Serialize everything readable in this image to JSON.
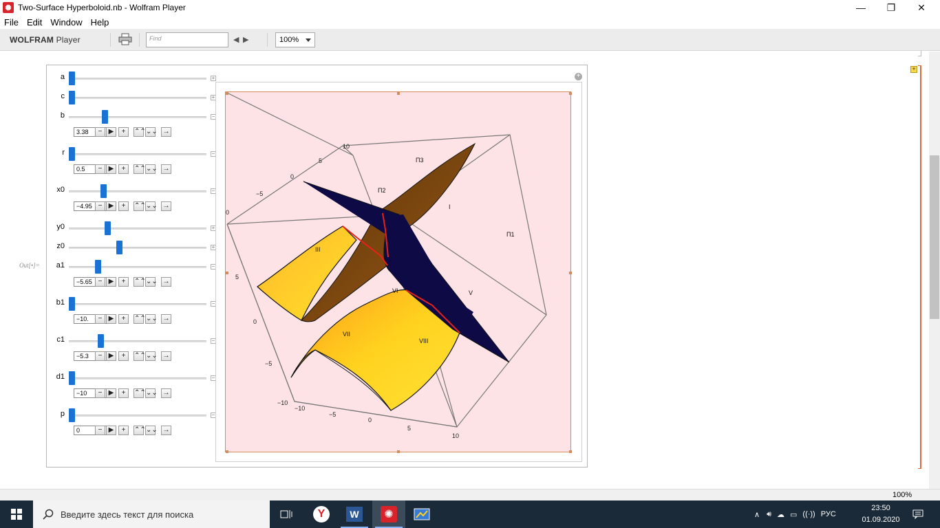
{
  "window": {
    "title": "Two-Surface Hyperboloid.nb - Wolfram Player",
    "minimize": "—",
    "maximize": "❐",
    "close": "✕"
  },
  "menu": [
    "File",
    "Edit",
    "Window",
    "Help"
  ],
  "toolbar": {
    "brand_bold": "WOLFRAM",
    "brand_rest": " Player",
    "find_placeholder": "Find",
    "zoom": "100%"
  },
  "notebook": {
    "out_label": "Out[•]="
  },
  "controls": [
    {
      "label": "a",
      "thumb": 0.0,
      "expanded": false
    },
    {
      "label": "c",
      "thumb": 0.0,
      "expanded": false
    },
    {
      "label": "b",
      "thumb": 0.25,
      "expanded": true,
      "value": "3.38"
    },
    {
      "label": "r",
      "thumb": 0.0,
      "expanded": true,
      "value": "0.5"
    },
    {
      "label": "x0",
      "thumb": 0.24,
      "expanded": true,
      "value": "−4.95"
    },
    {
      "label": "y0",
      "thumb": 0.27,
      "expanded": false
    },
    {
      "label": "z0",
      "thumb": 0.36,
      "expanded": false
    },
    {
      "label": "a1",
      "thumb": 0.2,
      "expanded": true,
      "value": "−5.65"
    },
    {
      "label": "b1",
      "thumb": 0.0,
      "expanded": true,
      "value": "−10."
    },
    {
      "label": "c1",
      "thumb": 0.22,
      "expanded": true,
      "value": "−5.3"
    },
    {
      "label": "d1",
      "thumb": 0.0,
      "expanded": true,
      "value": "−10"
    },
    {
      "label": "p",
      "thumb": 0.0,
      "expanded": true,
      "value": "0"
    }
  ],
  "plot": {
    "colors": {
      "background": "#fde3e5",
      "surface_light": "#ffd21f",
      "surface_dark": "#7a4a12",
      "plane": "#0d0a45",
      "edge": "#e8221a"
    },
    "region_labels": [
      "П3",
      "П2",
      "I",
      "П1",
      "III",
      "V",
      "VI",
      "VII",
      "VIII"
    ],
    "axis_top_ticks": [
      "10",
      "5",
      "0",
      "−5",
      "0"
    ],
    "axis_left_ticks": [
      "5",
      "0",
      "−5",
      "−10"
    ],
    "axis_bottom_ticks": [
      "−10",
      "−5",
      "0",
      "5",
      "10"
    ]
  },
  "status": {
    "zoom": "100%"
  },
  "taskbar": {
    "search_placeholder": "Введите здесь текст для поиска",
    "language": "РУС",
    "time": "23:50",
    "date": "01.09.2020"
  }
}
